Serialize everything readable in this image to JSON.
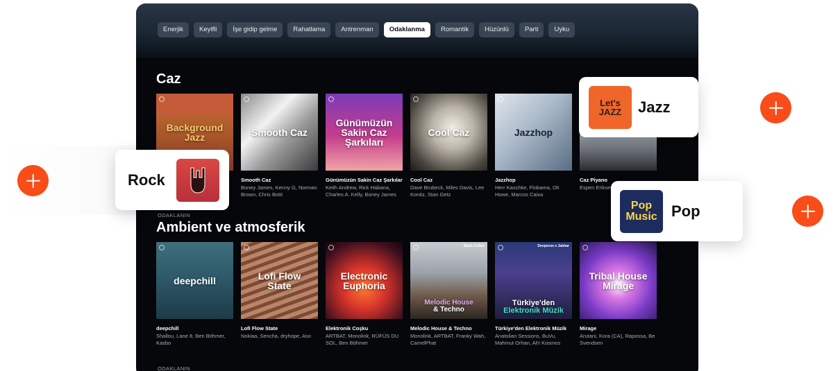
{
  "topbar": {
    "chips": [
      {
        "label": "Enerjik",
        "active": false
      },
      {
        "label": "Keyifli",
        "active": false
      },
      {
        "label": "İşe gidip gelme",
        "active": false
      },
      {
        "label": "Rahatlama",
        "active": false
      },
      {
        "label": "Antrenman",
        "active": false
      },
      {
        "label": "Odaklanma",
        "active": true
      },
      {
        "label": "Romantik",
        "active": false
      },
      {
        "label": "Hüzünlü",
        "active": false
      },
      {
        "label": "Parti",
        "active": false
      },
      {
        "label": "Uyku",
        "active": false
      }
    ]
  },
  "section_caz": {
    "title": "Caz",
    "cards": [
      {
        "cover_text": "Background Jazz",
        "title": "",
        "subtitle": ""
      },
      {
        "cover_text": "Smooth Caz",
        "title": "Smooth Caz",
        "subtitle": "Boney James, Kenny G, Norman Brown, Chris Botti"
      },
      {
        "cover_text": "Günümüzün Sakin Caz Şarkıları",
        "title": "Günümüzün Sakin Caz Şarkıları",
        "subtitle": "Keith Andrew, Rick Habana, Charles A. Kelly, Boney James"
      },
      {
        "cover_text": "Cool Caz",
        "title": "Cool Caz",
        "subtitle": "Dave Brubeck, Miles Davis, Lee Konitz, Stan Getz"
      },
      {
        "cover_text": "Jazzhop",
        "title": "Jazzhop",
        "subtitle": "Herr Kaschke, Flobama, Oli Howe, Marcos Caixa"
      },
      {
        "cover_text": "",
        "title": "Caz Piyano",
        "subtitle": "Espen Eriksen, Landström, N"
      }
    ]
  },
  "section_ambient": {
    "kicker": "ODAKLANIN",
    "title": "Ambient ve atmosferik",
    "cards": [
      {
        "cover_text": "deepchill",
        "title": "deepchill",
        "subtitle": "Shallou, Lane 8, Ben Böhmer, Kasbo"
      },
      {
        "cover_text": "Lofi Flow State",
        "title": "Lofi Flow State",
        "subtitle": "Nokiaa, Sencha, dryhope, Aso"
      },
      {
        "cover_text": "Electronic Euphoria",
        "title": "Elektronik Coşku",
        "subtitle": "ARTBAT, Monolink, RÜFÜS DU SOL, Ben Böhmer"
      },
      {
        "cover_text_line1": "Melodic House",
        "cover_text_line2": "& Techno",
        "badge": "Black Coffee",
        "title": "Melodic House & Techno",
        "subtitle": "Monolink, ARTBAT, Franky Wah, CamelPhat"
      },
      {
        "cover_text_line1": "Türkiye'den",
        "cover_text_line2": "Elektronik Müzik",
        "badge": "Deepense x Jabbar",
        "title": "Türkiye'den Elektronik Müzik",
        "subtitle": "Anatolian Sessions, BuVu, Mahmut Orhan, Ah! Kosmos"
      },
      {
        "cover_text": "Tribal House Mirage",
        "title": "Mirage",
        "subtitle": "Arutani, Kora (CA), Rapossa, Be Svendsen"
      }
    ]
  },
  "bottom_kicker": "ODAKLANIN",
  "genres": {
    "jazz": {
      "label": "Jazz",
      "thumb_text": "Let's JAZZ"
    },
    "rock": {
      "label": "Rock"
    },
    "pop": {
      "label": "Pop",
      "thumb_text": "Pop Music"
    }
  },
  "colors": {
    "accent": "#fa4c18",
    "background": "#06070b"
  }
}
